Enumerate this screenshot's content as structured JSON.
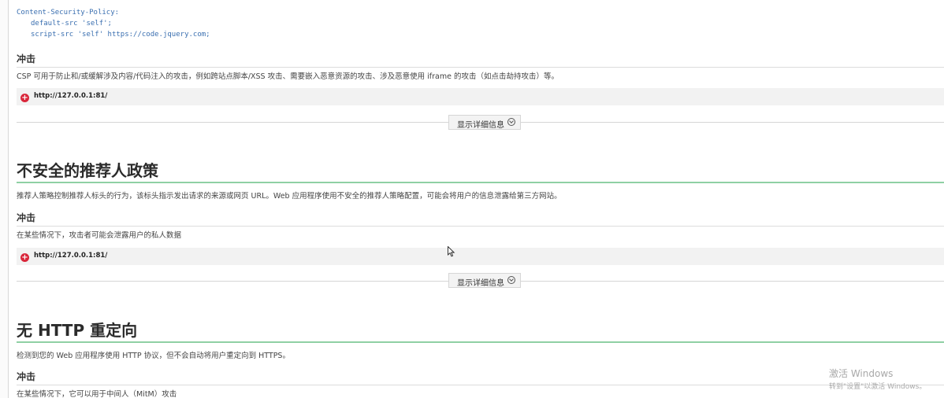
{
  "csp_code": {
    "line1": "Content-Security-Policy:",
    "line2": "default-src 'self';",
    "line3": "script-src 'self' https://code.jquery.com;"
  },
  "section_csp": {
    "impact_heading": "冲击",
    "impact_text": "CSP 可用于防止和/或缓解涉及内容/代码注入的攻击，例如跨站点脚本/XSS 攻击、需要嵌入恶意资源的攻击、涉及恶意使用 iframe 的攻击（如点击劫持攻击）等。",
    "url": "http://127.0.0.1:81/",
    "details_label": "显示详细信息"
  },
  "section_referrer": {
    "title": "不安全的推荐人政策",
    "description": "推荐人策略控制推荐人标头的行为，该标头指示发出请求的来源或网页 URL。Web 应用程序使用不安全的推荐人策略配置，可能会将用户的信息泄露给第三方网站。",
    "impact_heading": "冲击",
    "impact_text": "在某些情况下，攻击者可能会泄露用户的私人数据",
    "url": "http://127.0.0.1:81/",
    "details_label": "显示详细信息"
  },
  "section_redirect": {
    "title": "无 HTTP 重定向",
    "description": "检测到您的 Web 应用程序使用 HTTP 协议，但不会自动将用户重定向到 HTTPS。",
    "impact_heading": "冲击",
    "impact_text": "在某些情况下，它可以用于中间人（MitM）攻击"
  },
  "watermark": {
    "line1": "激活 Windows",
    "line2": "转到\"设置\"以激活 Windows。"
  },
  "icons": {
    "error": "error-circle-icon",
    "expand": "chevron-down-circle-icon",
    "cursor": "mouse-pointer-icon"
  },
  "colors": {
    "error_icon": "#d9263a",
    "section_underline": "#8fd0a4",
    "code_text": "#3a6fb0"
  }
}
